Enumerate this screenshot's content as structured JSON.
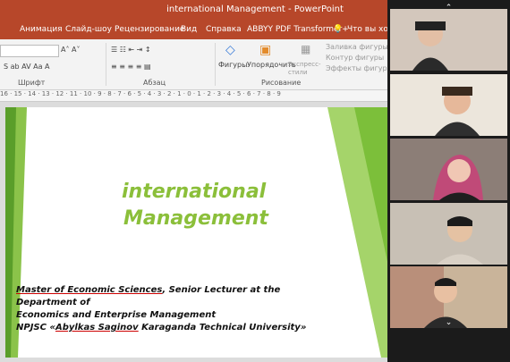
{
  "window": {
    "title": "international Management  -  PowerPoint"
  },
  "tabs": [
    "Анимация",
    "Слайд-шоу",
    "Рецензирование",
    "Вид",
    "Справка",
    "ABBYY PDF Transformer+",
    "Что вы хотит"
  ],
  "ribbon": {
    "shrift": "Шрифт",
    "abzac": "Абзац",
    "risovanie": "Рисование",
    "figury": "Фигуры",
    "uporyad": "Упорядочить",
    "ekspress": "Экспресс-стили",
    "zalivka": "Заливка фигуры",
    "kontur": "Контур фигуры",
    "effekty": "Эффекты фигуры"
  },
  "ruler": "16 · 15 · 14 · 13 · 12 · 11 · 10 · 9 · 8 · 7 · 6 · 5 · 4 · 3 · 2 · 1 · 0 · 1 · 2 · 3 · 4 · 5 · 6 · 7 · 8 · 9",
  "slide": {
    "title_line1": "international",
    "title_line2": "Management",
    "sub_line1_a": "Master of Economic Sciences",
    "sub_line1_b": ", Senior Lecturer at the Department of",
    "sub_line2": "Economics and Enterprise Management",
    "sub_line3_a": "NPJSC «",
    "sub_line3_b": "Abylkas Saginov",
    "sub_line3_c": " Karaganda Technical University»"
  },
  "colors": {
    "accent": "#b7472a",
    "title_green": "#8bbf3a"
  }
}
